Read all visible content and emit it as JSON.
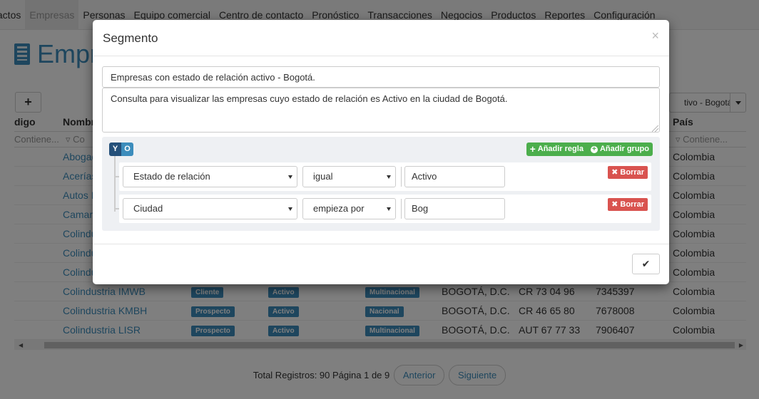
{
  "nav": [
    "tactos",
    "Empresas",
    "Personas",
    "Equipo comercial",
    "Centro de contacto",
    "Pronóstico",
    "Transacciones",
    "Negocios",
    "Productos",
    "Reportes",
    "Configuración"
  ],
  "page_title": "Empr",
  "add_label": "+",
  "segment_select": "tivo - Bogotá.",
  "grid": {
    "headers": [
      "digo",
      "Nombr",
      "País"
    ],
    "filter_placeholders": [
      "Contiene...",
      "Co",
      "Contiene..."
    ],
    "rows": [
      {
        "name": "Abogad",
        "c": "",
        "e": "",
        "t": "",
        "city": "",
        "addr": "",
        "phone": "",
        "country": "Colombia"
      },
      {
        "name": "Acerías",
        "c": "",
        "e": "",
        "t": "",
        "city": "",
        "addr": "",
        "phone": "",
        "country": "Colombia"
      },
      {
        "name": "Autos I",
        "c": "",
        "e": "",
        "t": "",
        "city": "",
        "addr": "",
        "phone": "",
        "country": "Colombia"
      },
      {
        "name": "Camara",
        "c": "",
        "e": "",
        "t": "",
        "city": "",
        "addr": "",
        "phone": "",
        "country": "Colombia"
      },
      {
        "name": "Colindu",
        "c": "",
        "e": "",
        "t": "",
        "city": "",
        "addr": "",
        "phone": "",
        "country": "Colombia"
      },
      {
        "name": "Colindu",
        "c": "",
        "e": "",
        "t": "",
        "city": "",
        "addr": "",
        "phone": "",
        "country": "Colombia"
      },
      {
        "name": "Colindu",
        "c": "",
        "e": "",
        "t": "",
        "city": "",
        "addr": "",
        "phone": "",
        "country": "Colombia"
      },
      {
        "name": "Colindustria IMWB",
        "c": "Cliente",
        "e": "Activo",
        "t": "Multinacional",
        "city": "BOGOTÁ, D.C.",
        "addr": "CR 73 04 96",
        "phone": "7345397",
        "country": "Colombia"
      },
      {
        "name": "Colindustria KMBH",
        "c": "Prospecto",
        "e": "Activo",
        "t": "Nacional",
        "city": "BOGOTÁ, D.C.",
        "addr": "CR 46 65 80",
        "phone": "7678008",
        "country": "Colombia"
      },
      {
        "name": "Colindustria LISR",
        "c": "Prospecto",
        "e": "Activo",
        "t": "Multinacional",
        "city": "BOGOTÁ, D.C.",
        "addr": "AUT 67 77 33",
        "phone": "7906407",
        "country": "Colombia"
      }
    ]
  },
  "pager": {
    "total": "Total Registros: 90 Página 1 de 9",
    "prev": "Anterior",
    "next": "Siguiente"
  },
  "modal": {
    "title": "Segmento",
    "close": "×",
    "name_value": "Empresas con estado de relación activo - Bogotá.",
    "description_value": "Consulta para visualizar las empresas cuyo estado de relación es Activo en la ciudad de Bogotá.",
    "cond_and": "Y",
    "cond_or": "O",
    "add_rule": "Añadir regla",
    "add_group": "Añadir grupo",
    "delete_label": "Borrar",
    "rules": [
      {
        "field": "Estado de relación",
        "operator": "igual",
        "value": "Activo"
      },
      {
        "field": "Ciudad",
        "operator": "empieza por",
        "value": "Bog"
      }
    ],
    "ok": "✔"
  },
  "colors": {
    "accent": "#3c8dbc",
    "success": "#4cae4c",
    "danger": "#d9534f",
    "dark_blue": "#24507a"
  }
}
